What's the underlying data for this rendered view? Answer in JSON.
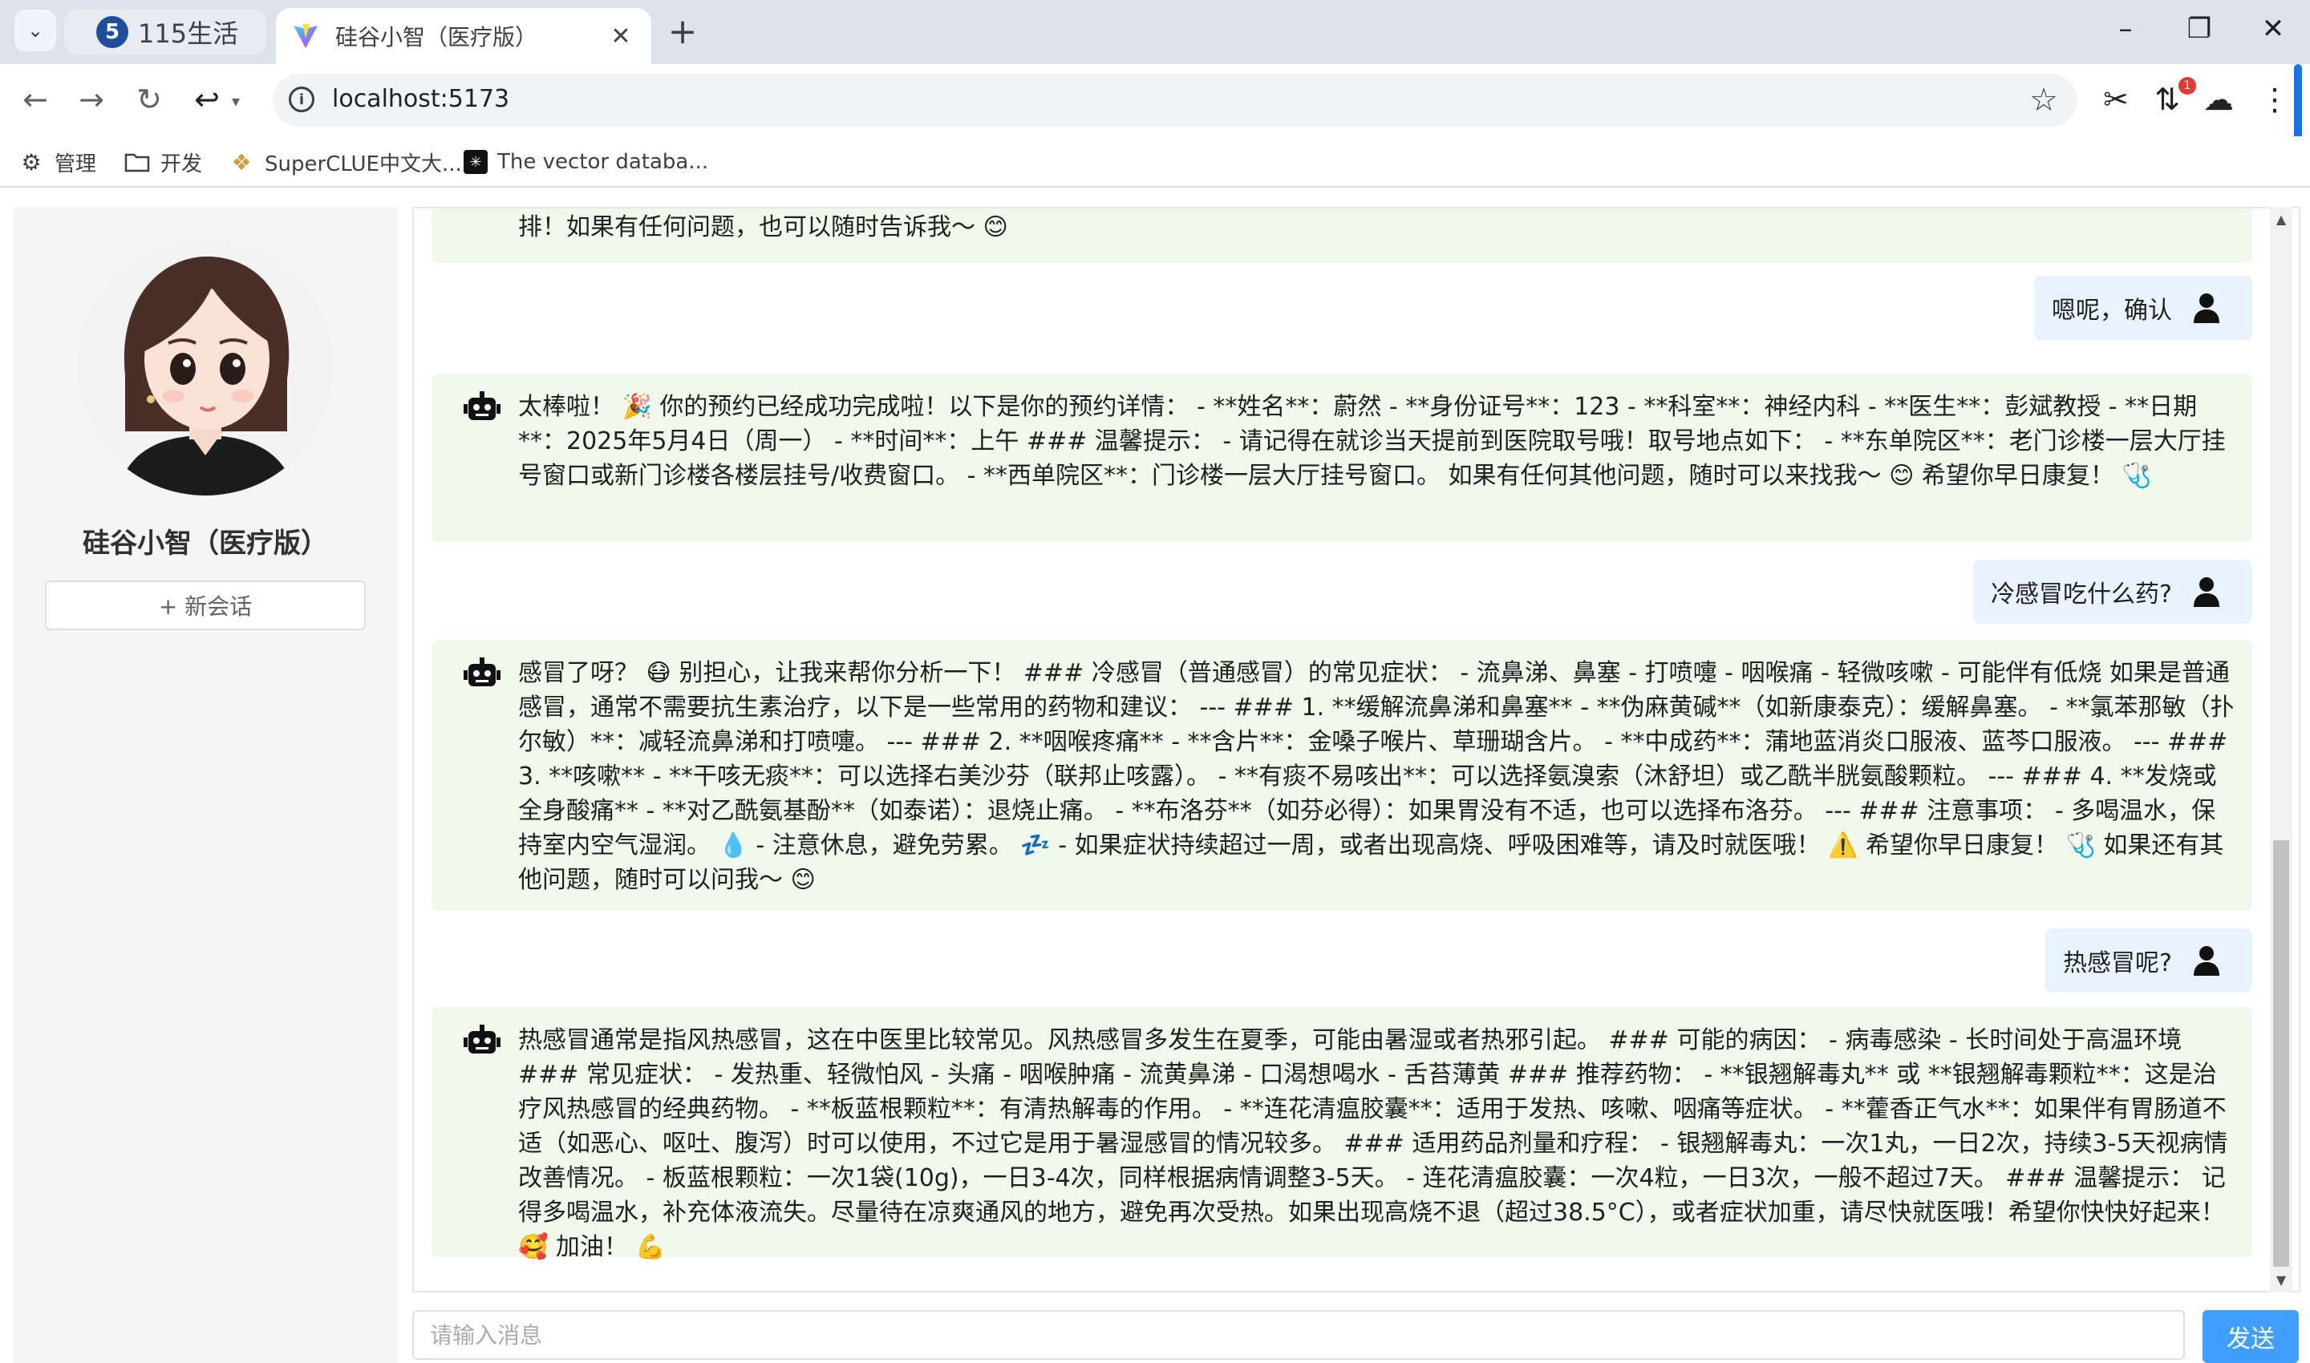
{
  "browser": {
    "tabs": [
      {
        "label": "115生活",
        "favicon": "5"
      },
      {
        "label": "硅谷小智（医疗版）"
      }
    ],
    "new_tab_label": "+",
    "url": "localhost:5173",
    "bookmarks": [
      {
        "label": "管理",
        "icon": "gear-icon"
      },
      {
        "label": "开发",
        "icon": "folder-icon"
      },
      {
        "label": "SuperCLUE中文大...",
        "icon": "superclue-icon"
      },
      {
        "label": "The vector databa...",
        "icon": "vector-db-icon"
      }
    ],
    "extension_badge": "1"
  },
  "sidebar": {
    "app_name": "硅谷小智（医疗版）",
    "new_chat_label": "+ 新会话"
  },
  "messages": [
    {
      "role": "bot",
      "text": "排！如果有任何问题，也可以随时告诉我～ 😊"
    },
    {
      "role": "user",
      "text": "嗯呢，确认"
    },
    {
      "role": "bot",
      "text": "太棒啦！ 🎉 你的预约已经成功完成啦！以下是你的预约详情： - **姓名**：蔚然 - **身份证号**：123 - **科室**：神经内科 - **医生**：彭斌教授 - **日期**：2025年5月4日（周一） - **时间**：上午 ### 温馨提示： - 请记得在就诊当天提前到医院取号哦！取号地点如下： - **东单院区**：老门诊楼一层大厅挂号窗口或新门诊楼各楼层挂号/收费窗口。 - **西单院区**：门诊楼一层大厅挂号窗口。 如果有任何其他问题，随时可以来找我～ 😊 希望你早日康复！ 🩺"
    },
    {
      "role": "user",
      "text": "冷感冒吃什么药?"
    },
    {
      "role": "bot",
      "text": "感冒了呀？ 😷 别担心，让我来帮你分析一下！ ### 冷感冒（普通感冒）的常见症状： - 流鼻涕、鼻塞 - 打喷嚏 - 咽喉痛 - 轻微咳嗽 - 可能伴有低烧 如果是普通感冒，通常不需要抗生素治疗，以下是一些常用的药物和建议： --- ### 1. **缓解流鼻涕和鼻塞** - **伪麻黄碱**（如新康泰克）：缓解鼻塞。 - **氯苯那敏（扑尔敏）**：减轻流鼻涕和打喷嚏。 --- ### 2. **咽喉疼痛** - **含片**：金嗓子喉片、草珊瑚含片。 - **中成药**：蒲地蓝消炎口服液、蓝芩口服液。 --- ### 3. **咳嗽** - **干咳无痰**：可以选择右美沙芬（联邦止咳露）。 - **有痰不易咳出**：可以选择氨溴索（沐舒坦）或乙酰半胱氨酸颗粒。 --- ### 4. **发烧或全身酸痛** - **对乙酰氨基酚**（如泰诺）：退烧止痛。 - **布洛芬**（如芬必得）：如果胃没有不适，也可以选择布洛芬。 --- ### 注意事项： - 多喝温水，保持室内空气湿润。 💧 - 注意休息，避免劳累。 💤 - 如果症状持续超过一周，或者出现高烧、呼吸困难等，请及时就医哦！ ⚠️ 希望你早日康复！ 🩺 如果还有其他问题，随时可以问我～ 😊"
    },
    {
      "role": "user",
      "text": "热感冒呢?"
    },
    {
      "role": "bot",
      "text": "热感冒通常是指风热感冒，这在中医里比较常见。风热感冒多发生在夏季，可能由暑湿或者热邪引起。 ### 可能的病因： - 病毒感染 - 长时间处于高温环境 ### 常见症状： - 发热重、轻微怕风 - 头痛 - 咽喉肿痛 - 流黄鼻涕 - 口渴想喝水 - 舌苔薄黄 ### 推荐药物： - **银翘解毒丸** 或 **银翘解毒颗粒**：这是治疗风热感冒的经典药物。 - **板蓝根颗粒**：有清热解毒的作用。 - **连花清瘟胶囊**：适用于发热、咳嗽、咽痛等症状。 - **藿香正气水**：如果伴有胃肠道不适（如恶心、呕吐、腹泻）时可以使用，不过它是用于暑湿感冒的情况较多。 ### 适用药品剂量和疗程： - 银翘解毒丸：一次1丸，一日2次，持续3-5天视病情改善情况。 - 板蓝根颗粒：一次1袋(10g)，一日3-4次，同样根据病情调整3-5天。 - 连花清瘟胶囊：一次4粒，一日3次，一般不超过7天。 ### 温馨提示： 记得多喝温水，补充体液流失。尽量待在凉爽通风的地方，避免再次受热。如果出现高烧不退（超过38.5°C），或者症状加重，请尽快就医哦！希望你快快好起来！ 🥰 加油！ 💪"
    }
  ],
  "input": {
    "placeholder": "请输入消息",
    "value": "",
    "send_label": "发送"
  },
  "colors": {
    "bot_bubble": "#f0f9eb",
    "user_bubble": "#e8f3ff",
    "send_button": "#409eff"
  }
}
